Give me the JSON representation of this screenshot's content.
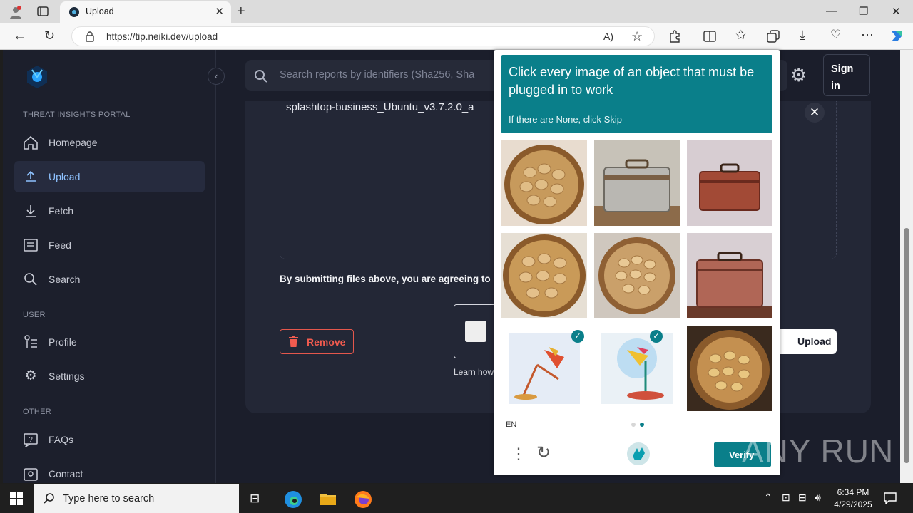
{
  "browser": {
    "tab_title": "Upload",
    "url": "https://tip.neiki.dev/upload"
  },
  "sidebar": {
    "sections": {
      "portal": "THREAT INSIGHTS PORTAL",
      "user": "USER",
      "other": "OTHER"
    },
    "items": [
      {
        "label": "Homepage",
        "icon": "home-icon"
      },
      {
        "label": "Upload",
        "icon": "upload-icon",
        "active": true
      },
      {
        "label": "Fetch",
        "icon": "fetch-icon"
      },
      {
        "label": "Feed",
        "icon": "feed-icon"
      },
      {
        "label": "Search",
        "icon": "search-icon"
      },
      {
        "label": "Profile",
        "icon": "profile-icon"
      },
      {
        "label": "Settings",
        "icon": "settings-icon"
      },
      {
        "label": "FAQs",
        "icon": "faq-icon"
      },
      {
        "label": "Contact",
        "icon": "contact-icon"
      }
    ]
  },
  "header": {
    "search_placeholder": "Search reports by identifiers (Sha256, Sha",
    "signin": "Sign in"
  },
  "main": {
    "filename": "splashtop-business_Ubuntu_v3.7.2.0_a",
    "agreement": "By submitting files above, you are agreeing to",
    "remove": "Remove",
    "learn_how": "Learn how",
    "upload": "Upload"
  },
  "captcha": {
    "prompt": "Click every image of an object that must be plugged in to work",
    "sub": "If there are None, click Skip",
    "tiles": [
      {
        "subject": "potatoes-basket",
        "selected": false
      },
      {
        "subject": "suitcase-silver",
        "selected": false
      },
      {
        "subject": "suitcase-brown",
        "selected": false
      },
      {
        "subject": "potatoes-basket",
        "selected": false
      },
      {
        "subject": "potatoes-basket",
        "selected": false
      },
      {
        "subject": "suitcase-brown",
        "selected": false
      },
      {
        "subject": "desk-lamp",
        "selected": true
      },
      {
        "subject": "desk-lamp",
        "selected": true
      },
      {
        "subject": "potatoes-basket",
        "selected": false
      }
    ],
    "language": "EN",
    "verify": "Verify"
  },
  "watermark": "ANY RUN",
  "taskbar": {
    "search_placeholder": "Type here to search",
    "time": "6:34 PM",
    "date": "4/29/2025"
  },
  "colors": {
    "captcha_accent": "#0a7f8a",
    "active_nav": "#8ec2ff",
    "remove": "#f25b4f"
  }
}
